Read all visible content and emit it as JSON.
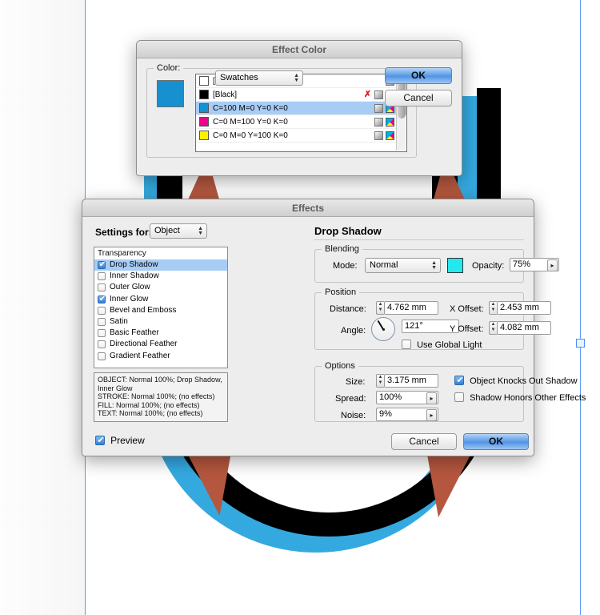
{
  "canvas": {
    "background_color": "#ffffff",
    "guide_color": "#5b9bf5",
    "artwork": {
      "stroke_color": "#000000",
      "shadow_color": "#34a9e0",
      "accent_color": "#b5573f"
    }
  },
  "effect_color_dialog": {
    "title": "Effect Color",
    "color_label": "Color:",
    "color_mode": "Swatches",
    "preview_color": "#1790d0",
    "swatches": [
      {
        "name": "[Paper]",
        "chip": "#ffffff",
        "selected": false,
        "has_slash": false,
        "has_gradient": true,
        "has_cmyk": false
      },
      {
        "name": "[Black]",
        "chip": "#000000",
        "selected": false,
        "has_slash": true,
        "has_gradient": true,
        "has_cmyk": true
      },
      {
        "name": "C=100 M=0 Y=0 K=0",
        "chip": "#1790d0",
        "selected": true,
        "has_slash": false,
        "has_gradient": true,
        "has_cmyk": true
      },
      {
        "name": "C=0 M=100 Y=0 K=0",
        "chip": "#ec008c",
        "selected": false,
        "has_slash": false,
        "has_gradient": true,
        "has_cmyk": true
      },
      {
        "name": "C=0 M=0 Y=100 K=0",
        "chip": "#fff200",
        "selected": false,
        "has_slash": false,
        "has_gradient": true,
        "has_cmyk": true
      }
    ],
    "ok_label": "OK",
    "cancel_label": "Cancel"
  },
  "effects_dialog": {
    "title": "Effects",
    "settings_for_label": "Settings for:",
    "settings_for_value": "Object",
    "panel_title": "Drop Shadow",
    "effects_list": {
      "header": "Transparency",
      "items": [
        {
          "label": "Drop Shadow",
          "checked": true,
          "selected": true
        },
        {
          "label": "Inner Shadow",
          "checked": false,
          "selected": false
        },
        {
          "label": "Outer Glow",
          "checked": false,
          "selected": false
        },
        {
          "label": "Inner Glow",
          "checked": true,
          "selected": false
        },
        {
          "label": "Bevel and Emboss",
          "checked": false,
          "selected": false
        },
        {
          "label": "Satin",
          "checked": false,
          "selected": false
        },
        {
          "label": "Basic Feather",
          "checked": false,
          "selected": false
        },
        {
          "label": "Directional Feather",
          "checked": false,
          "selected": false
        },
        {
          "label": "Gradient Feather",
          "checked": false,
          "selected": false
        }
      ]
    },
    "summary": "OBJECT: Normal 100%; Drop Shadow, Inner Glow\nSTROKE: Normal 100%; (no effects)\nFILL: Normal 100%; (no effects)\nTEXT: Normal 100%; (no effects)",
    "blending": {
      "group_label": "Blending",
      "mode_label": "Mode:",
      "mode_value": "Normal",
      "swatch_color": "#25e8ee",
      "opacity_label": "Opacity:",
      "opacity_value": "75%"
    },
    "position": {
      "group_label": "Position",
      "distance_label": "Distance:",
      "distance_value": "4.762 mm",
      "angle_label": "Angle:",
      "angle_value": "121°",
      "use_global_light_label": "Use Global Light",
      "use_global_light_checked": false,
      "x_offset_label": "X Offset:",
      "x_offset_value": "2.453 mm",
      "y_offset_label": "Y Offset:",
      "y_offset_value": "4.082 mm"
    },
    "options": {
      "group_label": "Options",
      "size_label": "Size:",
      "size_value": "3.175 mm",
      "spread_label": "Spread:",
      "spread_value": "100%",
      "noise_label": "Noise:",
      "noise_value": "9%",
      "knocks_out_label": "Object Knocks Out Shadow",
      "knocks_out_checked": true,
      "honors_effects_label": "Shadow Honors Other Effects",
      "honors_effects_checked": false
    },
    "preview_label": "Preview",
    "preview_checked": true,
    "cancel_label": "Cancel",
    "ok_label": "OK"
  }
}
